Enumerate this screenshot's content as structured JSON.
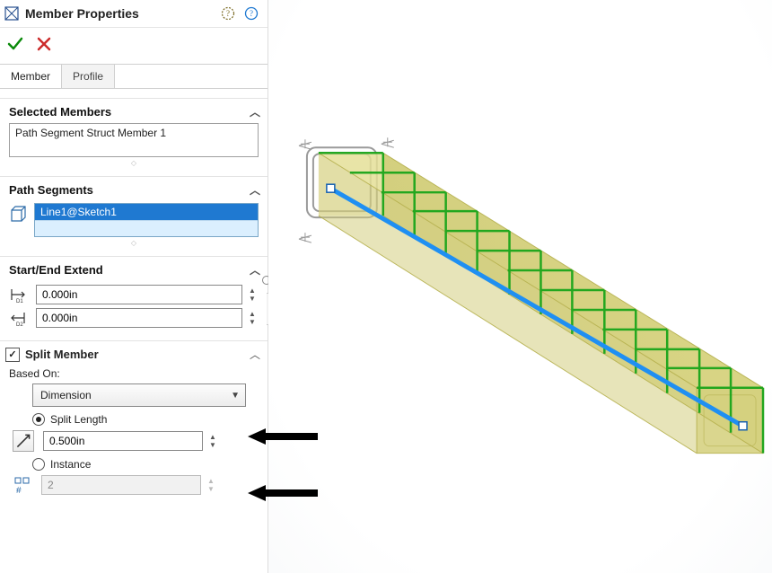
{
  "title": "Member Properties",
  "tabs": {
    "member": "Member",
    "profile": "Profile"
  },
  "groups": {
    "selected_members": {
      "header": "Selected Members",
      "item": "Path Segment Struct Member 1"
    },
    "path_segments": {
      "header": "Path Segments",
      "item": "Line1@Sketch1"
    },
    "start_end": {
      "header": "Start/End Extend",
      "d1": "0.000in",
      "d2": "0.000in"
    },
    "split": {
      "header": "Split Member",
      "based_on_label": "Based On:",
      "based_on_value": "Dimension",
      "split_length_label": "Split Length",
      "length_value": "0.500in",
      "instance_label": "Instance",
      "instance_value": "2"
    }
  }
}
